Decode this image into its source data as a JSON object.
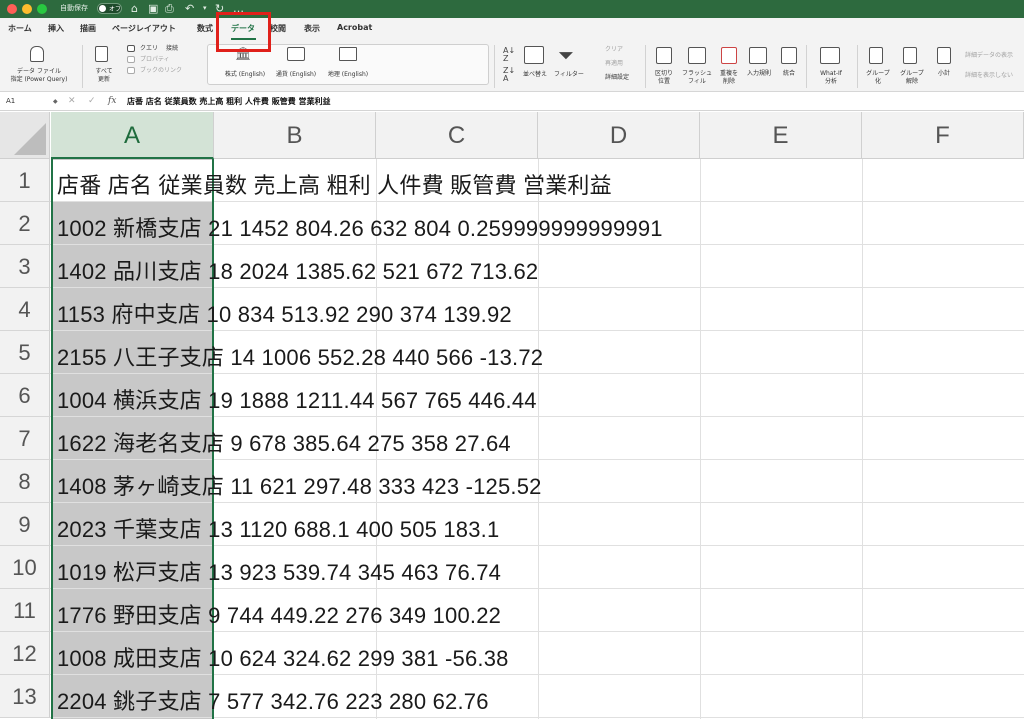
{
  "titlebar": {
    "autosave_label": "自動保存",
    "autosave_state": "オフ"
  },
  "tabs": [
    "ホーム",
    "挿入",
    "描画",
    "ページレイアウト",
    "数式",
    "データ",
    "校閲",
    "表示",
    "Acrobat"
  ],
  "active_tab": "データ",
  "ribbon": {
    "get_data_line1": "データ ファイル",
    "get_data_line2": "指定 (Power Query)",
    "refresh_line1": "すべて",
    "refresh_line2": "更新",
    "queries": "クエリ",
    "connections": "接続",
    "properties": "プロパティ",
    "edit_links": "ブックのリンク",
    "stocks": "株式 (English)",
    "currencies": "通貨 (English)",
    "geography": "地理 (English)",
    "sort": "並べ替え",
    "filter": "フィルター",
    "clear": "クリア",
    "reapply": "再適用",
    "advanced": "詳細設定",
    "text_to_columns_1": "区切り",
    "text_to_columns_2": "位置",
    "flash_fill_1": "フラッシュ",
    "flash_fill_2": "フィル",
    "remove_dup_1": "重複を",
    "remove_dup_2": "削除",
    "validation": "入力規則",
    "consolidate": "統合",
    "whatif_1": "What-If",
    "whatif_2": "分析",
    "group_1": "グループ",
    "group_2": "化",
    "ungroup_1": "グループ",
    "ungroup_2": "解除",
    "subtotal": "小計",
    "show_detail": "詳細データの表示",
    "hide_detail": "詳細を表示しない"
  },
  "formula_bar": {
    "cell_ref": "A1",
    "fx": "fx",
    "formula": "店番 店名 従業員数 売上高 粗利 人件費 販管費 営業利益"
  },
  "columns": [
    "A",
    "B",
    "C",
    "D",
    "E",
    "F"
  ],
  "rows": [
    {
      "num": "1",
      "text": "店番 店名 従業員数 売上高 粗利 人件費 販管費 営業利益"
    },
    {
      "num": "2",
      "text": "1002 新橋支店 21 1452 804.26 632 804 0.259999999999991"
    },
    {
      "num": "3",
      "text": "1402 品川支店 18 2024 1385.62 521 672 713.62"
    },
    {
      "num": "4",
      "text": "1153 府中支店 10 834 513.92 290 374 139.92"
    },
    {
      "num": "5",
      "text": "2155 八王子支店 14 1006 552.28 440 566 -13.72"
    },
    {
      "num": "6",
      "text": "1004 横浜支店 19 1888 1211.44 567 765 446.44"
    },
    {
      "num": "7",
      "text": "1622 海老名支店 9 678 385.64 275 358 27.64"
    },
    {
      "num": "8",
      "text": "1408 茅ヶ崎支店 11 621 297.48 333 423 -125.52"
    },
    {
      "num": "9",
      "text": "2023 千葉支店 13 1120 688.1 400 505 183.1"
    },
    {
      "num": "10",
      "text": "1019 松戸支店 13 923 539.74 345 463 76.74"
    },
    {
      "num": "11",
      "text": "1776 野田支店 9 744 449.22 276 349 100.22"
    },
    {
      "num": "12",
      "text": "1008 成田支店 10 624 324.62 299 381 -56.38"
    },
    {
      "num": "13",
      "text": "2204 銚子支店 7 577 342.76 223 280 62.76"
    }
  ],
  "colors": {
    "titlebar": "#2d6a3e",
    "accent": "#217346",
    "highlight": "#e0201a",
    "selected_column": "#c8c8c8"
  }
}
